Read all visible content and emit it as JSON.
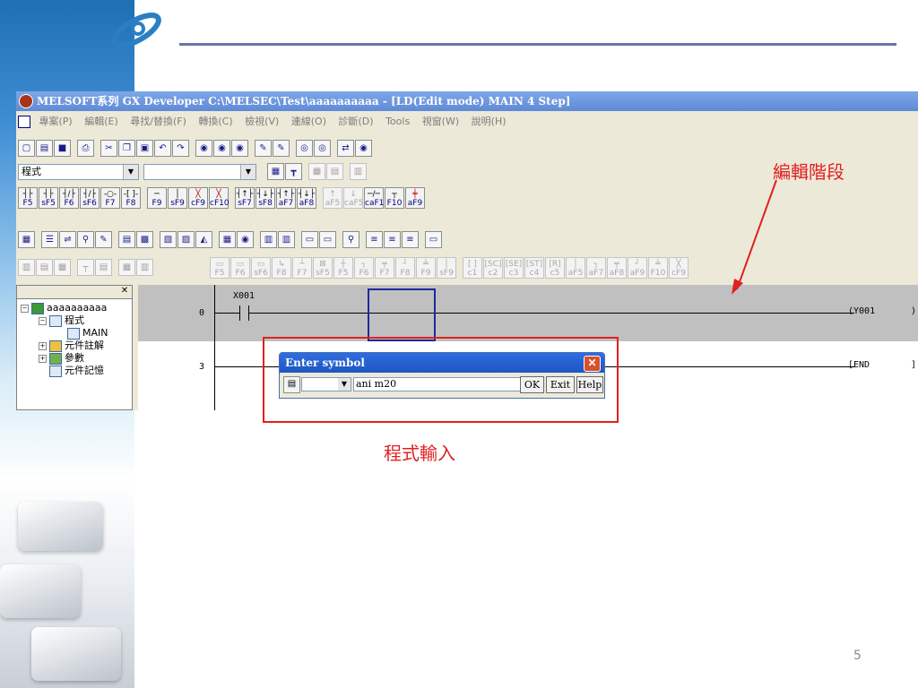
{
  "window": {
    "title": "MELSOFT系列 GX Developer C:\\MELSEC\\Test\\aaaaaaaaaa - [LD(Edit mode)    MAIN    4 Step]"
  },
  "menu": [
    "專案(P)",
    "編輯(E)",
    "尋找/替換(F)",
    "轉換(C)",
    "檢視(V)",
    "連線(O)",
    "診斷(D)",
    "Tools",
    "視窗(W)",
    "說明(H)"
  ],
  "toolbar": {
    "combo_program": "程式",
    "combo_second": ""
  },
  "fkeys_row1": [
    {
      "sym": "┤├",
      "key": "F5"
    },
    {
      "sym": "┤├",
      "key": "sF5"
    },
    {
      "sym": "┤/├",
      "key": "F6"
    },
    {
      "sym": "┤/├",
      "key": "sF6"
    },
    {
      "sym": "-○-",
      "key": "F7"
    },
    {
      "sym": "-[ ]-",
      "key": "F8"
    },
    {
      "sym": "─",
      "key": "F9"
    },
    {
      "sym": "│",
      "key": "sF9"
    },
    {
      "sym": "╳",
      "key": "cF9"
    },
    {
      "sym": "╳",
      "key": "cF10"
    },
    {
      "sym": "┤↑├",
      "key": "sF7"
    },
    {
      "sym": "┤↓├",
      "key": "sF8"
    },
    {
      "sym": "┤↑├",
      "key": "aF7"
    },
    {
      "sym": "┤↓├",
      "key": "aF8"
    },
    {
      "sym": "↑",
      "key": "aF5"
    },
    {
      "sym": "↓",
      "key": "caF5"
    },
    {
      "sym": "─/─",
      "key": "caF10"
    },
    {
      "sym": "┬",
      "key": "F10"
    },
    {
      "sym": "╪",
      "key": "aF9"
    }
  ],
  "fkeys_row4": [
    "F5",
    "F6",
    "sF6",
    "F8",
    "F7",
    "sF5",
    "F5",
    "F6",
    "F7",
    "F8",
    "F9",
    "sF9",
    "c1",
    "c2",
    "c3",
    "c4",
    "c5",
    "aF5",
    "aF7",
    "aF8",
    "aF9",
    "F10",
    "cF9"
  ],
  "fkeys_row4_sym": [
    "",
    "",
    "",
    "",
    "",
    "",
    "",
    "",
    "",
    "",
    "",
    "",
    "",
    "[SC]",
    "[SE]",
    "[ST]",
    "[R]",
    "",
    "",
    "",
    "",
    "",
    ""
  ],
  "tree": {
    "root": "aaaaaaaaaa",
    "program": "程式",
    "main": "MAIN",
    "comment": "元件註解",
    "param": "參數",
    "memory": "元件記憶"
  },
  "ladder": {
    "rows": [
      {
        "step": "0",
        "contact": "X001",
        "coil": "(Y001",
        "coil_end": ")"
      },
      {
        "step": "3",
        "coil": "[END",
        "coil_end": "]"
      }
    ]
  },
  "dialog": {
    "title": "Enter symbol",
    "input_value": "ani m20",
    "ok": "OK",
    "exit": "Exit",
    "help": "Help"
  },
  "annotations": {
    "edit_ladder": "編輯階段",
    "program_input": "程式輸入"
  },
  "colors": {
    "annotation_red": "#e02020",
    "titlebar_blue": "#5f8ad7",
    "cursor_blue": "#1a2a9a"
  },
  "page_number": "5"
}
